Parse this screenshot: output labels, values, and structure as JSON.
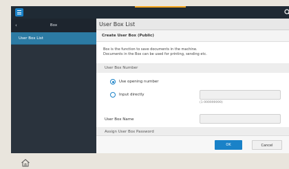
{
  "sidebar": {
    "header_title": "Box",
    "back_glyph": "‹",
    "items": [
      {
        "label": "User Box List"
      }
    ]
  },
  "main": {
    "title": "User Box List",
    "subtitle": "Create User Box (Public)",
    "description_line1": "Box is the function to save documents in the machine.",
    "description_line2": "Documents in the Box can be used for printing, sending etc.",
    "section_box_number": "User Box Number",
    "option_use_opening": "Use opening number",
    "option_input_directly": "Input directly",
    "selected_option": "Use opening number",
    "input_direct_value": "",
    "range_hint": "(1-999999999)",
    "box_name_label": "User Box Name",
    "box_name_value": "",
    "section_password": "Assign User Box Password"
  },
  "footer": {
    "ok_label": "OK",
    "cancel_label": "Cancel"
  },
  "icons": {
    "menu": "menu-icon",
    "search": "search-icon",
    "more": "more-vertical-icon",
    "home": "home-icon"
  },
  "colors": {
    "accent_blue": "#1a82c8",
    "selected_item": "#2c7ba4",
    "topbar": "#1f2a34",
    "sidebar": "#2a333d",
    "top_accent": "#f3a31a"
  }
}
